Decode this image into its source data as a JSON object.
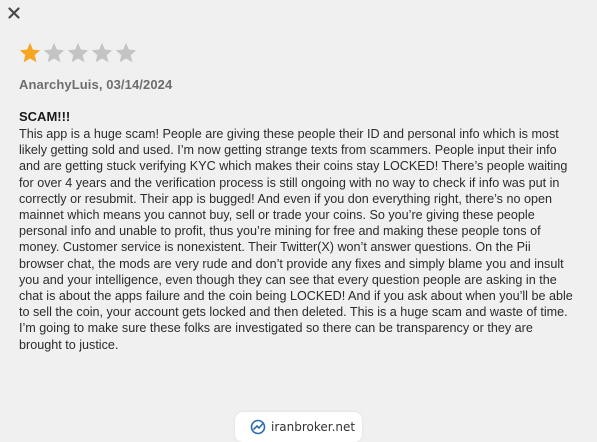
{
  "header": {
    "close_icon": "close-icon"
  },
  "rating": {
    "value": 1,
    "max": 5,
    "filled_color": "#f5a623",
    "empty_color": "#c4c4c4"
  },
  "review": {
    "author_date": "AnarchyLuis, 03/14/2024",
    "title": "SCAM!!!",
    "body": "This app is a huge scam! People are giving these people their ID and personal info which is most likely getting sold and used. I’m now getting strange texts from scammers. People input their info and are getting stuck verifying KYC which makes their coins stay LOCKED! There’s people waiting for over 4 years and the verification process is still ongoing with no way to check if info was put in correctly or resubmit. Their app is bugged! And even if you don everything right, there’s no open mainnet which means you cannot buy, sell or trade your coins. So you’re giving these people personal info and unable to profit, thus you’re mining for free and making these people tons of money. Customer service is nonexistent. Their Twitter(X) won’t answer questions. On the Pii browser chat, the mods are very rude and don’t provide any fixes and simply blame you and insult you and your intelligence, even though they can see that every question people are asking in the chat is about the apps failure and the coin being LOCKED! And if you ask about when you’ll be able to sell the coin, your account gets locked and then deleted. This is a huge scam and waste of time. I’m going to make sure these folks are investigated so there can be transparency or they are brought to justice."
  },
  "watermark": {
    "text": "iranbroker.net",
    "color": "#2b6cb0"
  }
}
